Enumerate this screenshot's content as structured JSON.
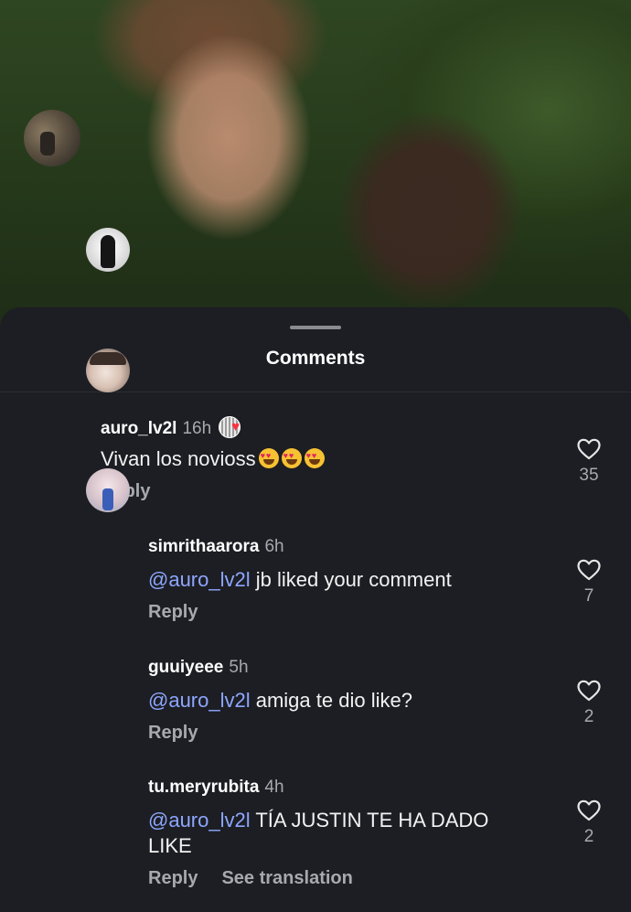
{
  "sheet": {
    "title": "Comments"
  },
  "comments": [
    {
      "username": "auro_lv2l",
      "time": "16h",
      "text": "Vivan los novioss",
      "emoji_count": 3,
      "reply_label": "Reply",
      "likes": "35"
    },
    {
      "username": "simrithaarora",
      "time": "6h",
      "mention": "@auro_lv2l",
      "text": " jb liked your comment",
      "reply_label": "Reply",
      "likes": "7"
    },
    {
      "username": "guuiyeee",
      "time": "5h",
      "mention": "@auro_lv2l",
      "text": " amiga te dio like?",
      "reply_label": "Reply",
      "likes": "2"
    },
    {
      "username": "tu.meryrubita",
      "time": "4h",
      "mention": "@auro_lv2l",
      "text": " TÍA JUSTIN TE HA DADO",
      "text_line2": "LIKE",
      "reply_label": "Reply",
      "translate_label": "See translation",
      "likes": "2"
    }
  ],
  "colors": {
    "sheet_bg": "#1c1e23",
    "mention": "#8ea6ff",
    "muted": "#a7a9ad",
    "heart_badge": "#ff3040"
  },
  "icons": [
    "heart-outline-icon",
    "creator-liked-heart-icon",
    "heart-eyes-emoji"
  ]
}
